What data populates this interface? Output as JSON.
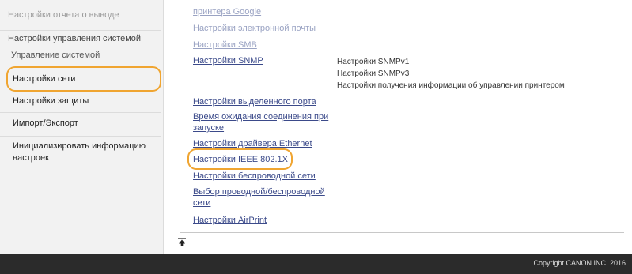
{
  "sidebar": {
    "report_settings": "Настройки отчета о выводе",
    "system_management_settings": "Настройки управления системой",
    "system_management": "Управление системой",
    "network_settings": "Настройки сети",
    "security_settings": "Настройки защиты",
    "import_export": "Импорт/Экспорт",
    "initialize_settings": "Инициализировать информацию настроек"
  },
  "main": {
    "links": {
      "google_printer": "принтера Google",
      "email_settings": "Настройки электронной почты",
      "smb_settings": "Настройки SMB",
      "snmp_settings": "Настройки SNMP",
      "dedicated_port": "Настройки выделенного порта",
      "connection_wait_time": "Время ожидания соединения при запуске",
      "ethernet_driver": "Настройки драйвера Ethernet",
      "ieee_8021x": "Настройки IEEE 802.1X",
      "wireless_lan": "Настройки беспроводной сети",
      "wired_wireless_select": "Выбор проводной/беспроводной сети",
      "airprint": "Настройки AirPrint"
    },
    "snmp_notes": [
      "Настройки SNMPv1",
      "Настройки SNMPv3",
      "Настройки получения информации об управлении принтером"
    ]
  },
  "footer": {
    "copyright": "Copyright CANON INC. 2016"
  },
  "colors": {
    "highlight": "#f0a531",
    "link": "#3b4a8a",
    "footer_bg": "#2b2b2b"
  },
  "icons": {
    "scroll_top": "scroll-to-top-icon"
  }
}
